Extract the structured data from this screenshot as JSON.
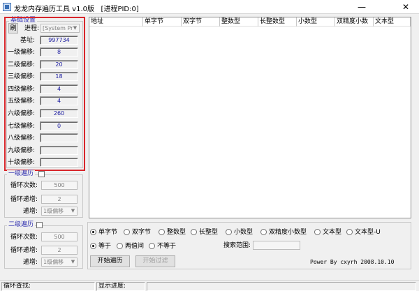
{
  "window": {
    "title": "龙龙内存遍历工具 v1.0版",
    "pid_label": "[进程PID:0]",
    "minimize_glyph": "—",
    "close_glyph": "✕"
  },
  "base_settings": {
    "legend": "基础设置",
    "refresh_label": "刷",
    "process_label": "进程:",
    "process_value": "[System Pr",
    "base_label": "基址:",
    "base_value": "997734",
    "offsets": [
      {
        "label": "一级偏移:",
        "value": "8"
      },
      {
        "label": "二级偏移:",
        "value": "20"
      },
      {
        "label": "三级偏移:",
        "value": "18"
      },
      {
        "label": "四级偏移:",
        "value": "4"
      },
      {
        "label": "五级偏移:",
        "value": "4"
      },
      {
        "label": "六级偏移:",
        "value": "260"
      },
      {
        "label": "七级偏移:",
        "value": "0"
      },
      {
        "label": "八级偏移:",
        "value": ""
      },
      {
        "label": "九级偏移:",
        "value": ""
      },
      {
        "label": "十级偏移:",
        "value": ""
      }
    ]
  },
  "level1": {
    "legend": "一级遍历",
    "loop_label": "循环次数:",
    "loop_value": "500",
    "step_label": "循环递增:",
    "step_value": "2",
    "source_label": "递增:",
    "source_value": "1级偏移"
  },
  "level2": {
    "legend": "二级遍历",
    "loop_label": "循环次数:",
    "loop_value": "500",
    "step_label": "循环递增:",
    "step_value": "2",
    "source_label": "递增:",
    "source_value": "1级偏移"
  },
  "table": {
    "columns": [
      "地址",
      "单字节",
      "双字节",
      "整数型",
      "长整数型",
      "小数型",
      "双精度小数",
      "文本型"
    ]
  },
  "types": {
    "selected_index": 0,
    "options": [
      "单字节",
      "双字节",
      "整数型",
      "长整型",
      "小数型",
      "双精度小数型",
      "文本型",
      "文本型-U"
    ]
  },
  "compare": {
    "selected_index": 0,
    "options": [
      "等于",
      "两值间",
      "不等于"
    ],
    "range_label": "搜索范围:"
  },
  "buttons": {
    "start": "开始遍历",
    "filter": "开始过滤"
  },
  "credit": "Power By cxyrh 2008.10.10",
  "status": {
    "loop_find": "循环查找:",
    "progress": "显示进度:"
  },
  "colors": {
    "highlight_frame": "#d8262b",
    "legend_text": "#3030b0",
    "value_text": "#1a1aa0"
  }
}
